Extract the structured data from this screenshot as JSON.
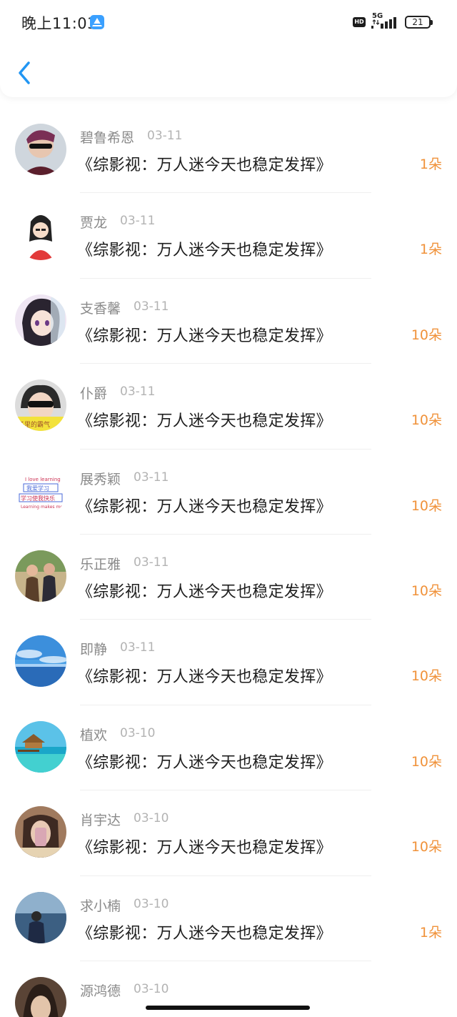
{
  "status_bar": {
    "time": "晚上11:03",
    "network": "5G",
    "hd": "HD",
    "battery": "21"
  },
  "colors": {
    "accent": "#2196f3",
    "count": "#f0923a"
  },
  "list": [
    {
      "name": "碧鲁希恩",
      "date": "03-11",
      "title": "《综影视：万人迷今天也稳定发挥》",
      "count": "1朵",
      "avatar": "avatar-sunglasses-man"
    },
    {
      "name": "贾龙",
      "date": "03-11",
      "title": "《综影视：万人迷今天也稳定发挥》",
      "count": "1朵",
      "avatar": "avatar-cartoon-girl-red"
    },
    {
      "name": "支香馨",
      "date": "03-11",
      "title": "《综影视：万人迷今天也稳定发挥》",
      "count": "10朵",
      "avatar": "avatar-anime-girl"
    },
    {
      "name": "仆爵",
      "date": "03-11",
      "title": "《综影视：万人迷今天也稳定发挥》",
      "count": "10朵",
      "avatar": "avatar-sunglasses-yellow"
    },
    {
      "name": "展秀颖",
      "date": "03-11",
      "title": "《综影视：万人迷今天也稳定发挥》",
      "count": "10朵",
      "avatar": "avatar-learning-text"
    },
    {
      "name": "乐正雅",
      "date": "03-11",
      "title": "《综影视：万人迷今天也稳定发挥》",
      "count": "10朵",
      "avatar": "avatar-couple-photo"
    },
    {
      "name": "即静",
      "date": "03-11",
      "title": "《综影视：万人迷今天也稳定发挥》",
      "count": "10朵",
      "avatar": "avatar-sky-sea"
    },
    {
      "name": "植欢",
      "date": "03-10",
      "title": "《综影视：万人迷今天也稳定发挥》",
      "count": "10朵",
      "avatar": "avatar-beach-hut"
    },
    {
      "name": "肖宇达",
      "date": "03-10",
      "title": "《综影视：万人迷今天也稳定发挥》",
      "count": "10朵",
      "avatar": "avatar-selfie"
    },
    {
      "name": "求小楠",
      "date": "03-10",
      "title": "《综影视：万人迷今天也稳定发挥》",
      "count": "1朵",
      "avatar": "avatar-lake-person"
    },
    {
      "name": "源鸿德",
      "date": "03-10",
      "title": "",
      "count": "",
      "avatar": "avatar-partial"
    }
  ]
}
